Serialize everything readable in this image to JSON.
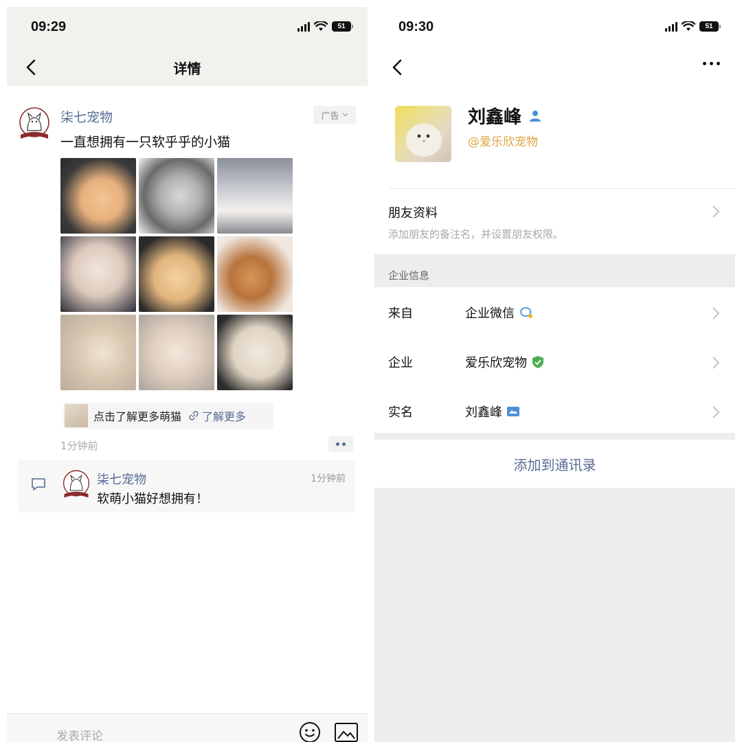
{
  "left": {
    "status": {
      "time": "09:29",
      "battery": "51"
    },
    "nav": {
      "title": "详情"
    },
    "post": {
      "author": "柒七宠物",
      "ad_label": "广告",
      "text": "一直想拥有一只软乎乎的小猫",
      "images": [
        "cat-1",
        "cat-2",
        "cat-3",
        "cat-4",
        "cat-5",
        "cat-6",
        "cat-7",
        "cat-8",
        "cat-9"
      ],
      "learn_more": {
        "text": "点击了解更多萌猫",
        "link": "了解更多"
      },
      "time": "1分钟前"
    },
    "comment": {
      "author": "柒七宠物",
      "time": "1分钟前",
      "text": "软萌小猫好想拥有！"
    },
    "comment_bar": {
      "placeholder": "发表评论"
    }
  },
  "right": {
    "status": {
      "time": "09:30",
      "battery": "51"
    },
    "profile": {
      "name": "刘鑫峰",
      "corp": "@爱乐欣宠物"
    },
    "friend_info": {
      "title": "朋友资料",
      "subtitle": "添加朋友的备注名，并设置朋友权限。"
    },
    "enterprise": {
      "section_title": "企业信息",
      "rows": [
        {
          "label": "来自",
          "value": "企业微信"
        },
        {
          "label": "企业",
          "value": "爱乐欣宠物"
        },
        {
          "label": "实名",
          "value": "刘鑫峰"
        }
      ]
    },
    "add_button": "添加到通讯录"
  },
  "colors": {
    "link_blue": "#576b95",
    "corp_orange": "#d9a441",
    "verified_green": "#4caf50",
    "contact_blue": "#4a90d9"
  }
}
